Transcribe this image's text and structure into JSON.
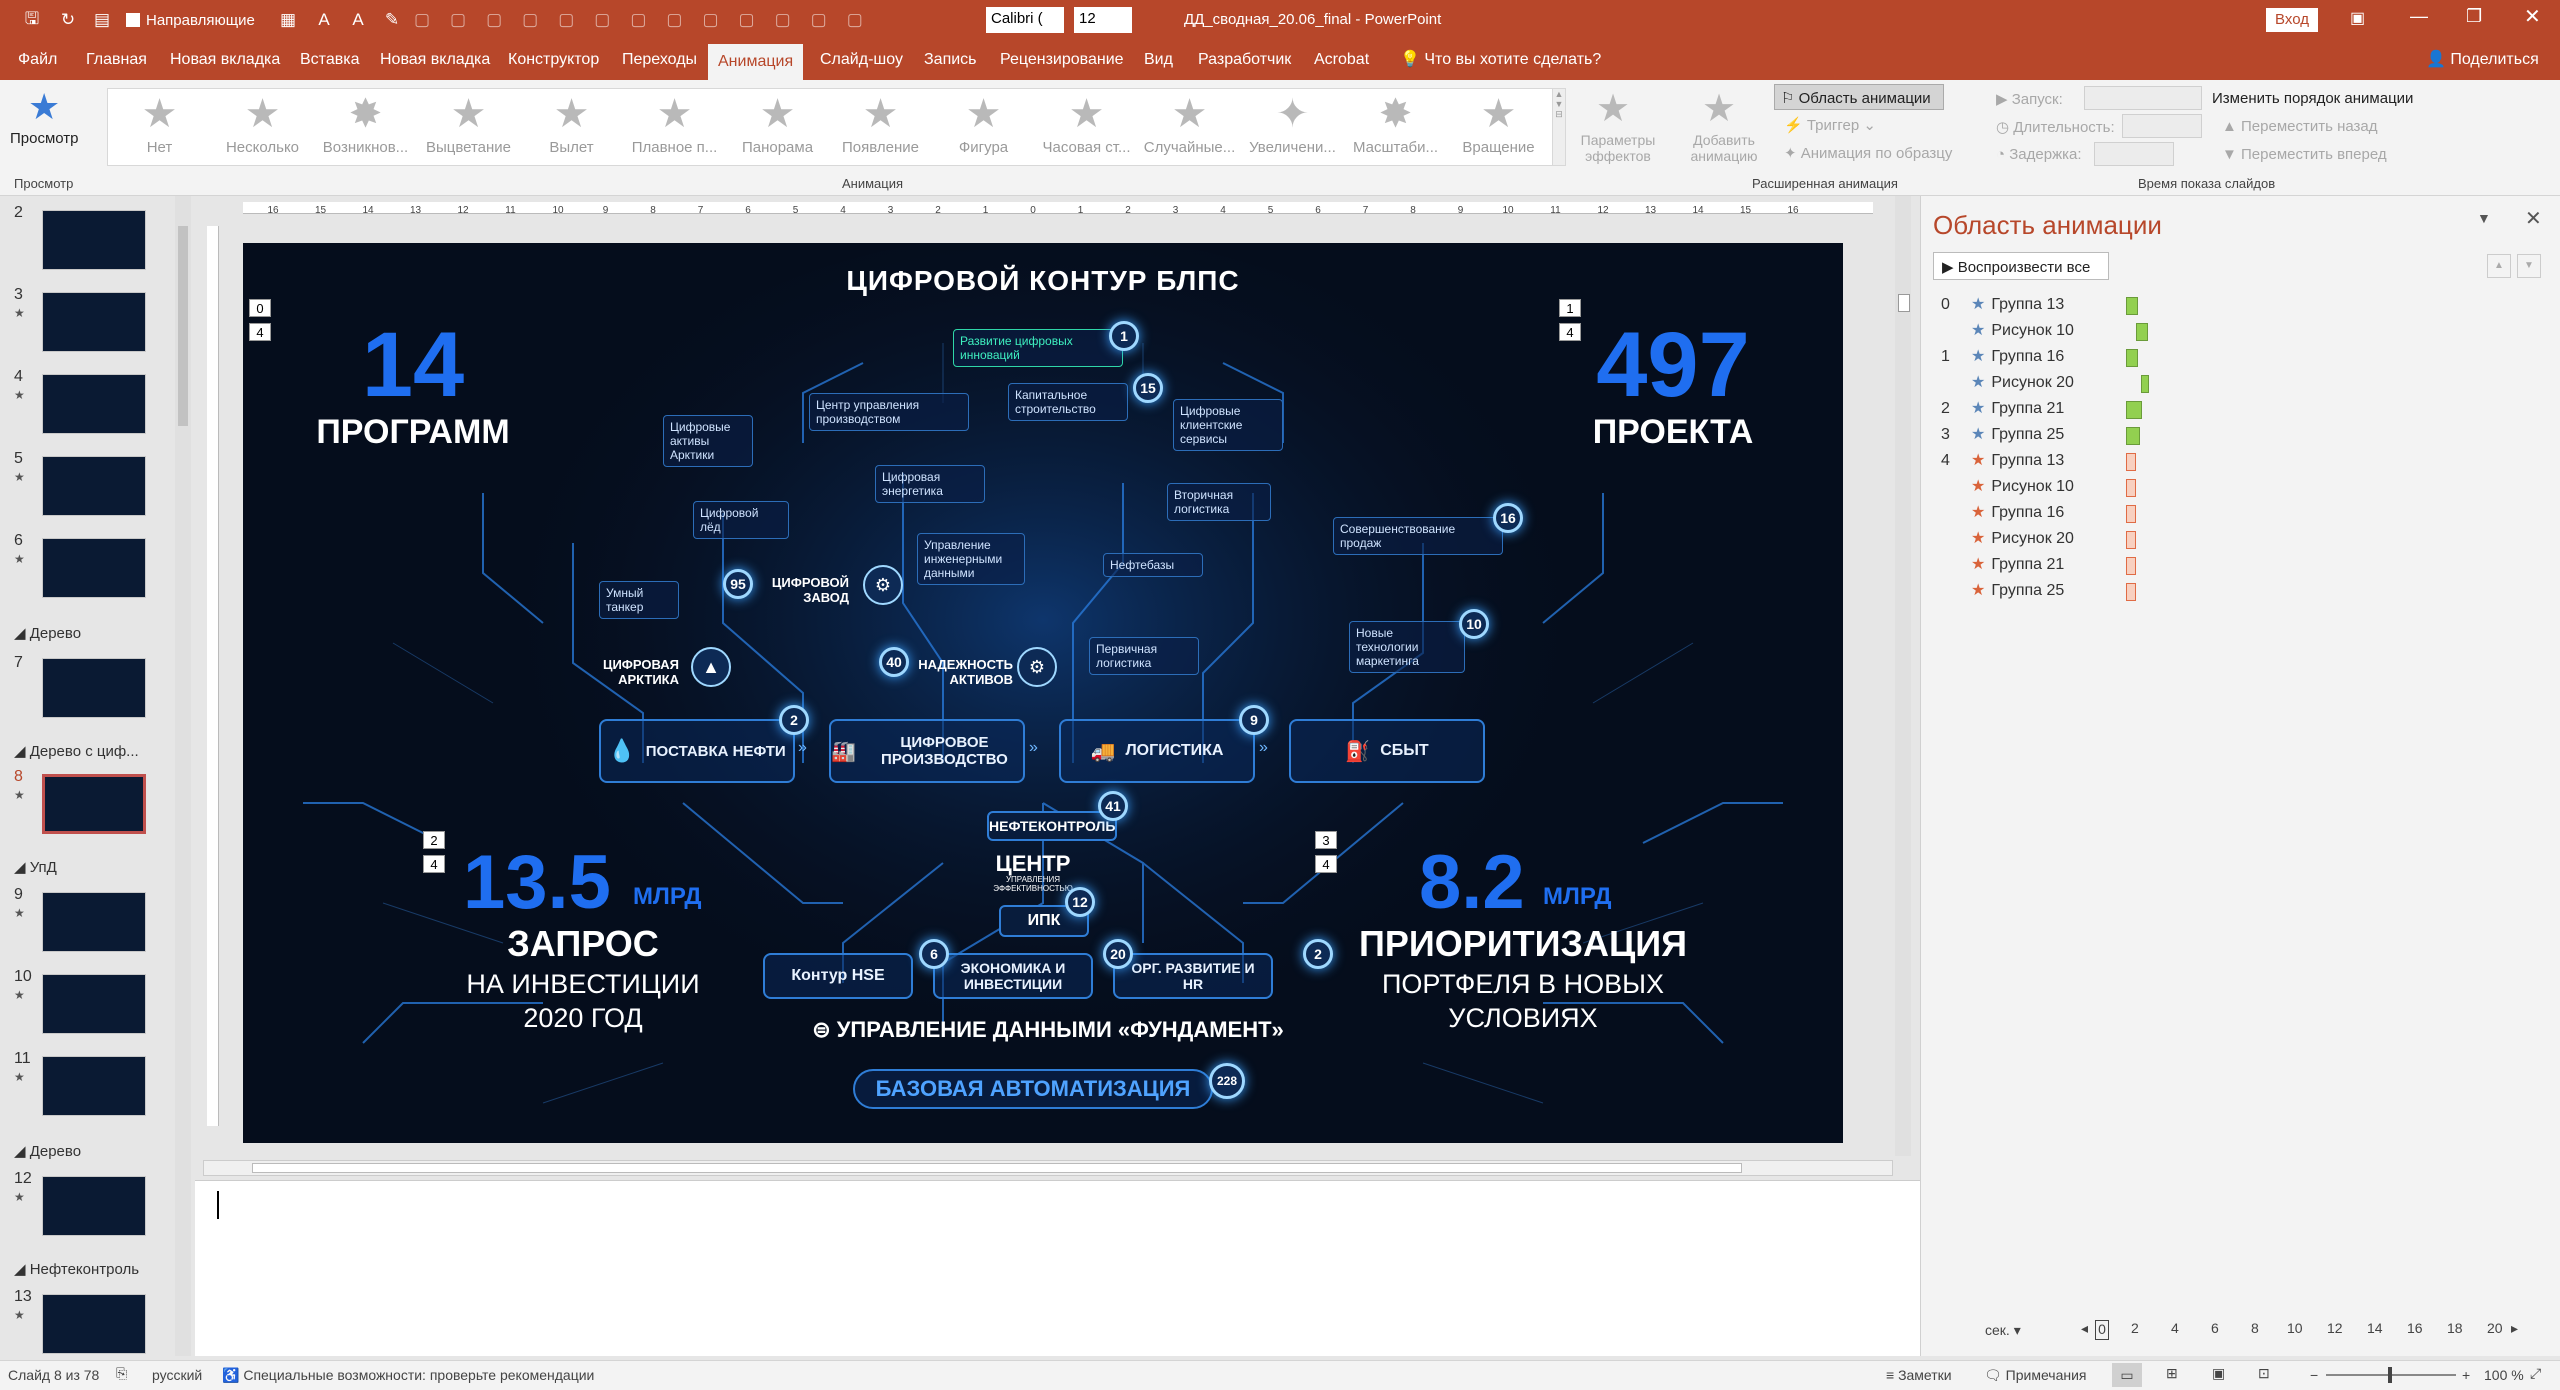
{
  "window": {
    "quick_font_checkbox": "Направляющие",
    "font_name": "Calibri (",
    "font_size": "12",
    "doc_title": "ДД_сводная_20.06_final",
    "app": "PowerPoint",
    "signin": "Вход"
  },
  "tabs": [
    "Файл",
    "Главная",
    "Новая вкладка",
    "Вставка",
    "Новая вкладка",
    "Конструктор",
    "Переходы",
    "Анимация",
    "Слайд-шоу",
    "Запись",
    "Рецензирование",
    "Вид",
    "Разработчик",
    "Acrobat"
  ],
  "tell_me": "Что вы хотите сделать?",
  "share": "Поделиться",
  "ribbon": {
    "preview": "Просмотр",
    "preview_group": "Просмотр",
    "effects": [
      "Нет",
      "Несколько",
      "Возникнов...",
      "Выцветание",
      "Вылет",
      "Плавное п...",
      "Панорама",
      "Появление",
      "Фигура",
      "Часовая ст...",
      "Случайные...",
      "Увеличени...",
      "Масштаби...",
      "Вращение"
    ],
    "effect_params": "Параметры эффектов",
    "animation_group": "Анимация",
    "add_animation": "Добавить анимацию",
    "anim_pane": "Область анимации",
    "trigger": "Триггер",
    "anim_painter": "Анимация по образцу",
    "adv_group": "Расширенная анимация",
    "start": "Запуск:",
    "duration": "Длительность:",
    "delay": "Задержка:",
    "reorder": "Изменить порядок анимации",
    "move_back": "Переместить назад",
    "move_fwd": "Переместить вперед",
    "timing_group": "Время показа слайдов"
  },
  "thumbs": {
    "numbers": [
      "2",
      "3",
      "4",
      "5",
      "6",
      "7",
      "8",
      "9",
      "10",
      "11",
      "12",
      "13"
    ],
    "sections": [
      "Дерево",
      "Дерево с циф...",
      "УпД",
      "Дерево",
      "Нефтеконтроль"
    ]
  },
  "ruler_marks": [
    "16",
    "15",
    "14",
    "13",
    "12",
    "11",
    "10",
    "9",
    "8",
    "7",
    "6",
    "5",
    "4",
    "3",
    "2",
    "1",
    "0",
    "1",
    "2",
    "3",
    "4",
    "5",
    "6",
    "7",
    "8",
    "9",
    "10",
    "11",
    "12",
    "13",
    "14",
    "15",
    "16"
  ],
  "slide": {
    "title": "ЦИФРОВОЙ КОНТУР БЛПС",
    "left_top": {
      "number": "14",
      "label": "ПРОГРАММ"
    },
    "right_top": {
      "number": "497",
      "label": "ПРОЕКТА"
    },
    "left_bottom": {
      "number": "13.5",
      "unit": "МЛРД",
      "label": "ЗАПРОС",
      "sub1": "НА ИНВЕСТИЦИИ",
      "sub2": "2020 ГОД"
    },
    "right_bottom": {
      "number": "8.2",
      "unit": "МЛРД",
      "label": "ПРИОРИТИЗАЦИЯ",
      "sub1": "ПОРТФЕЛЯ В НОВЫХ",
      "sub2": "УСЛОВИЯХ"
    },
    "main_boxes": [
      {
        "label": "ПОСТАВКА НЕФТИ"
      },
      {
        "label": "ЦИФРОВОЕ ПРОИЗВОДСТВО"
      },
      {
        "label": "ЛОГИСТИКА"
      },
      {
        "label": "СБЫТ"
      }
    ],
    "small": [
      "Развитие цифровых инноваций",
      "Центр управления производством",
      "Капитальное строительство",
      "Цифровые клиентские сервисы",
      "Цифровые активы Арктики",
      "Цифровая энергетика",
      "Цифровой лёд",
      "Вторичная логистика",
      "Совершенствование продаж",
      "Управление инженерными данными",
      "Нефтебазы",
      "Умный танкер",
      "Новые технологии маркетинга",
      "Первичная логистика"
    ],
    "labels": {
      "zavod": "ЦИФРОВОЙ ЗАВОД",
      "arktika": "ЦИФРОВАЯ АРКТИКА",
      "nadezh": "НАДЕЖНОСТЬ АКТИВОВ",
      "neftekontrol": "НЕФТЕКОНТРОЛЬ",
      "centr": "ЦЕНТР",
      "centr_sub": "УПРАВЛЕНИЯ ЭФФЕКТИВНОСТЬЮ",
      "ipk": "ИПК",
      "hse": "Контур HSE",
      "econ": "ЭКОНОМИКА И ИНВЕСТИЦИИ",
      "org": "ОРГ. РАЗВИТИЕ И HR",
      "data_mgmt": "УПРАВЛЕНИЕ ДАННЫМИ «ФУНДАМЕНТ»",
      "base": "БАЗОВАЯ АВТОМАТИЗАЦИЯ"
    },
    "badges": [
      "1",
      "15",
      "16",
      "10",
      "95",
      "40",
      "2",
      "9",
      "41",
      "12",
      "6",
      "20",
      "2",
      "228"
    ],
    "anim_markers": [
      "0",
      "4",
      "1",
      "4",
      "2",
      "4",
      "3",
      "4"
    ]
  },
  "anim_pane": {
    "title": "Область анимации",
    "play_all": "Воспроизвести все",
    "items": [
      {
        "n": "0",
        "name": "Группа 13"
      },
      {
        "n": "",
        "name": "Рисунок 10"
      },
      {
        "n": "1",
        "name": "Группа 16"
      },
      {
        "n": "",
        "name": "Рисунок 20"
      },
      {
        "n": "2",
        "name": "Группа 21"
      },
      {
        "n": "3",
        "name": "Группа 25"
      },
      {
        "n": "4",
        "name": "Группа 13"
      },
      {
        "n": "",
        "name": "Рисунок 10"
      },
      {
        "n": "",
        "name": "Группа 16"
      },
      {
        "n": "",
        "name": "Рисунок 20"
      },
      {
        "n": "",
        "name": "Группа 21"
      },
      {
        "n": "",
        "name": "Группа 25"
      }
    ],
    "sec": "сек.",
    "timeline": [
      "0",
      "2",
      "4",
      "6",
      "8",
      "10",
      "12",
      "14",
      "16",
      "18",
      "20"
    ]
  },
  "status": {
    "slide": "Слайд 8 из 78",
    "lang": "русский",
    "access": "Специальные возможности: проверьте рекомендации",
    "notes": "Заметки",
    "comments": "Примечания",
    "zoom": "100 %"
  },
  "colors": {
    "accent": "#b7472a",
    "slide_bg": "#050d1c",
    "blue": "#1f6ef0"
  }
}
